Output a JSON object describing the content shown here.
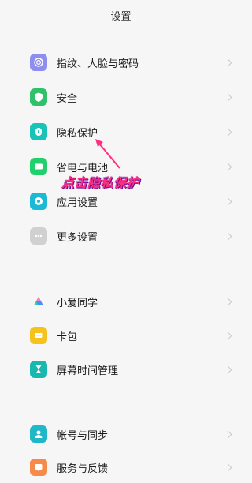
{
  "header": {
    "title": "设置"
  },
  "groups": [
    {
      "items": [
        {
          "label": "指纹、人脸与密码",
          "icon": "fingerprint-icon",
          "color": "#8e8df0"
        },
        {
          "label": "安全",
          "icon": "shield-icon",
          "color": "#2fc26a"
        },
        {
          "label": "隐私保护",
          "icon": "privacy-icon",
          "color": "#18c3b8"
        },
        {
          "label": "省电与电池",
          "icon": "battery-icon",
          "color": "#20d06a"
        },
        {
          "label": "应用设置",
          "icon": "gear-icon",
          "color": "#1ab9d6"
        },
        {
          "label": "更多设置",
          "icon": "more-icon",
          "color": "#c9c9c9"
        }
      ]
    },
    {
      "items": [
        {
          "label": "小爱同学",
          "icon": "xiaoai-icon",
          "color": "#4a8df7"
        },
        {
          "label": "卡包",
          "icon": "wallet-icon",
          "color": "#f6c21c"
        },
        {
          "label": "屏幕时间管理",
          "icon": "hourglass-icon",
          "color": "#18b8b0"
        }
      ]
    },
    {
      "items": [
        {
          "label": "帐号与同步",
          "icon": "account-icon",
          "color": "#20b8c8"
        },
        {
          "label": "服务与反馈",
          "icon": "feedback-icon",
          "color": "#f58a4a"
        }
      ]
    }
  ],
  "annotation": {
    "text": "点击隐私保护",
    "color": "#ff2e7e"
  }
}
